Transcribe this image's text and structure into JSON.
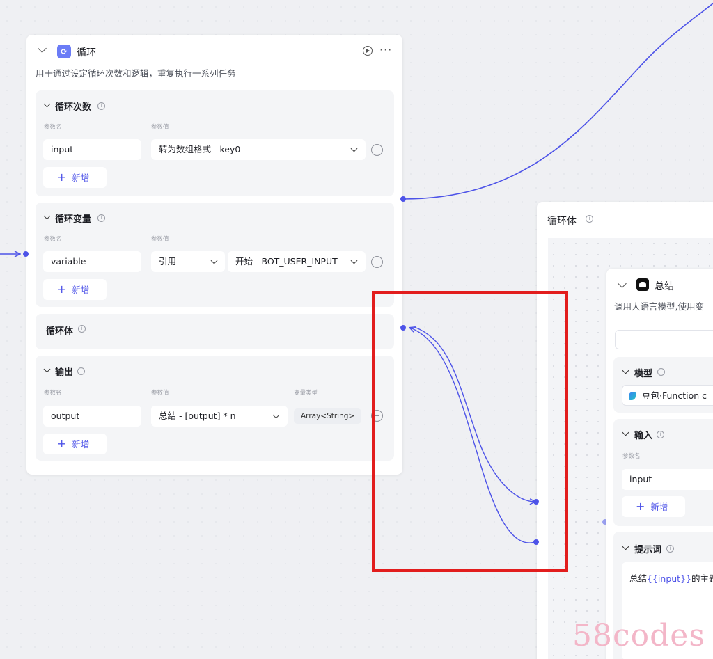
{
  "loop_node": {
    "icon": "loop-icon",
    "title": "循环",
    "description": "用于通过设定循环次数和逻辑，重复执行一系列任务",
    "loop_count": {
      "title": "循环次数",
      "param_name_label": "参数名",
      "param_value_label": "参数值",
      "rows": [
        {
          "name": "input",
          "value": "转为数组格式 - key0"
        }
      ],
      "add_label": "新增"
    },
    "loop_variable": {
      "title": "循环变量",
      "param_name_label": "参数名",
      "param_value_label": "参数值",
      "rows": [
        {
          "name": "variable",
          "mode": "引用",
          "value": "开始 - BOT_USER_INPUT"
        }
      ],
      "add_label": "新增"
    },
    "loop_body": {
      "title": "循环体"
    },
    "output": {
      "title": "输出",
      "param_name_label": "参数名",
      "param_value_label": "参数值",
      "type_label": "变量类型",
      "rows": [
        {
          "name": "output",
          "value": "总结 - [output] * n",
          "type": "Array<String>"
        }
      ],
      "add_label": "新增"
    }
  },
  "loop_body_container": {
    "title": "循环体",
    "summary_node": {
      "title": "总结",
      "description": "调用大语言模型,使用变",
      "model": {
        "title": "模型",
        "value": "豆包·Function c"
      },
      "input": {
        "title": "输入",
        "param_name_label": "参数名",
        "rows": [
          {
            "name": "input"
          }
        ],
        "add_label": "新增"
      },
      "prompt": {
        "title": "提示词",
        "text_prefix": "总结",
        "text_var": "{{input}}",
        "text_suffix": "的主题"
      }
    }
  },
  "watermark": "58codes",
  "colors": {
    "accent": "#4d53e8",
    "highlight": "#e21d1d",
    "canvas": "#eff0f3"
  }
}
